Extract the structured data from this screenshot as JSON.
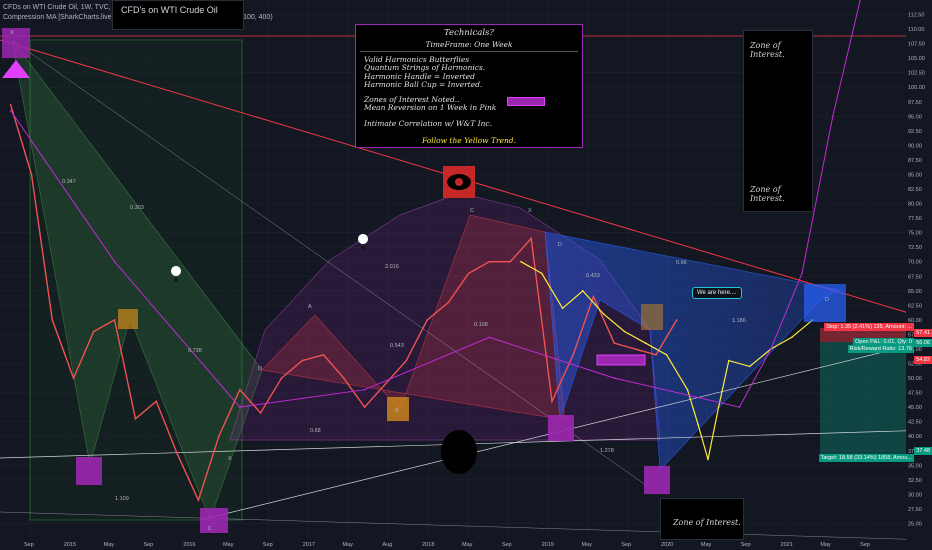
{
  "header": {
    "symbol_line": "CFDs on WTI Crude Oil, 1W, TVC, Heikin Ashi",
    "indicator_line": "Compression MA [SharkCharts.live] (1.25, 2.2, 3.25, 2.2, 3.2, 100, 0.4, close, 100, 400)",
    "title_box": "CFD's on WTI Crude Oil"
  },
  "technicals": {
    "title": "Technicals?",
    "timeframe": "TimeFrame: One Week",
    "lines_a": [
      "Valid Harmonics Butterflies",
      "Quantum Strings of Harmonics.",
      "Harmonic Handle = Inverted",
      "Harmonic Ball Cup = Inverted."
    ],
    "lines_b": [
      "Zones of Interest Noted..",
      "Mean Reversion on 1 Week in Pink"
    ],
    "line_c": "Intimate Correlation w/ W&T Inc.",
    "footer": "Follow the Yellow Trend."
  },
  "zones": [
    "Zone of Interest.",
    "Zone of Interest.",
    "Zone of Interest."
  ],
  "callout": "We are here....",
  "pattern_labels": {
    "X": "X",
    "A": "A",
    "B": "B",
    "C": "C",
    "D": "D"
  },
  "ratios": [
    "0.347",
    "0.303",
    "0.738",
    "2.016",
    "0.543",
    "0.108",
    "0.68",
    "1.109",
    "0.433",
    "0.66",
    "1.186",
    "1.278"
  ],
  "price_tags": {
    "stop": "Stop: 1.35 (2.41%) 135, Amount: ...",
    "open": "Open P&L: 0.01, Qty: 0",
    "rr": "Risk/Reward Ratio: 13.76",
    "target": "Target: 18.58 (33.14%) 1858, Amou...",
    "p1": "57.41",
    "p2": "56.06",
    "p3": "54.82",
    "p4": "37.48"
  },
  "colors": {
    "background": "#131722",
    "harmonic_purple": "#9c27b0",
    "harmonic_red": "#f44336",
    "harmonic_blue": "#2962ff",
    "yellow_trend": "#ffeb3b",
    "pink_mean": "#e040fb",
    "stop_red": "#f23645",
    "target_green": "#089981"
  },
  "chart_data": {
    "type": "line",
    "title": "CFD's on WTI Crude Oil",
    "xlabel": "",
    "ylabel": "",
    "ylim": [
      22.5,
      115
    ],
    "x_ticks": [
      "Sep",
      "2015",
      "May",
      "Sep",
      "2016",
      "May",
      "Sep",
      "2017",
      "May",
      "Aug",
      "2018",
      "May",
      "Sep",
      "2019",
      "May",
      "Sep",
      "2020",
      "May",
      "Sep",
      "2021",
      "May",
      "Sep"
    ],
    "y_ticks": [
      25,
      27.5,
      30,
      32.5,
      35,
      37.5,
      40,
      42.5,
      45,
      47.5,
      50,
      52.5,
      55,
      57.5,
      60,
      62.5,
      65,
      67.5,
      70,
      72.5,
      75,
      77.5,
      80,
      82.5,
      85,
      87.5,
      90,
      92.5,
      95,
      97.5,
      100,
      102.5,
      105,
      107.5,
      110,
      112.5
    ],
    "series": [
      {
        "name": "",
        "x": [
          "2014-08",
          "2014-10",
          "2014-12",
          "2015-02",
          "2015-04",
          "2015-06",
          "2015-08",
          "2015-10",
          "2015-12",
          "2016-02",
          "2016-04",
          "2016-06",
          "2016-08",
          "2016-10",
          "2016-12",
          "2017-02",
          "2017-04",
          "2017-06",
          "2017-08",
          "2017-10",
          "2017-12",
          "2018-02",
          "2018-04",
          "2018-06",
          "2018-08",
          "2018-10",
          "2018-12",
          "2019-02",
          "2019-04",
          "2019-06",
          "2019-08",
          "2019-10",
          "2019-12"
        ],
        "values": [
          97,
          85,
          60,
          50,
          58,
          60,
          43,
          46,
          37,
          29,
          40,
          48,
          44,
          50,
          53,
          54,
          50,
          45,
          49,
          53,
          60,
          63,
          68,
          70,
          70,
          74,
          46,
          54,
          64,
          56,
          55,
          54,
          60
        ]
      },
      {
        "name": "",
        "x": [
          "2018-09",
          "2018-11",
          "2019-01",
          "2019-03",
          "2019-05",
          "2019-07",
          "2019-09",
          "2019-11",
          "2020-01",
          "2020-02",
          "2020-03",
          "2020-04",
          "2020-05",
          "2020-07",
          "2020-09",
          "2020-11",
          "2021-01"
        ],
        "values": [
          70,
          68,
          62,
          65,
          61,
          58,
          56,
          54,
          48,
          42,
          36,
          45,
          53,
          52,
          55,
          57,
          60
        ]
      },
      {
        "name": "",
        "x": [
          "2014-08",
          "2015-06",
          "2016-06",
          "2017-06",
          "2018-06",
          "2019-06",
          "2020-06",
          "2020-09",
          "2020-12",
          "2021-03",
          "2021-06"
        ],
        "values": [
          96,
          70,
          45,
          48,
          57,
          50,
          45,
          55,
          68,
          95,
          118
        ]
      }
    ],
    "grid": true,
    "legend": "none"
  }
}
